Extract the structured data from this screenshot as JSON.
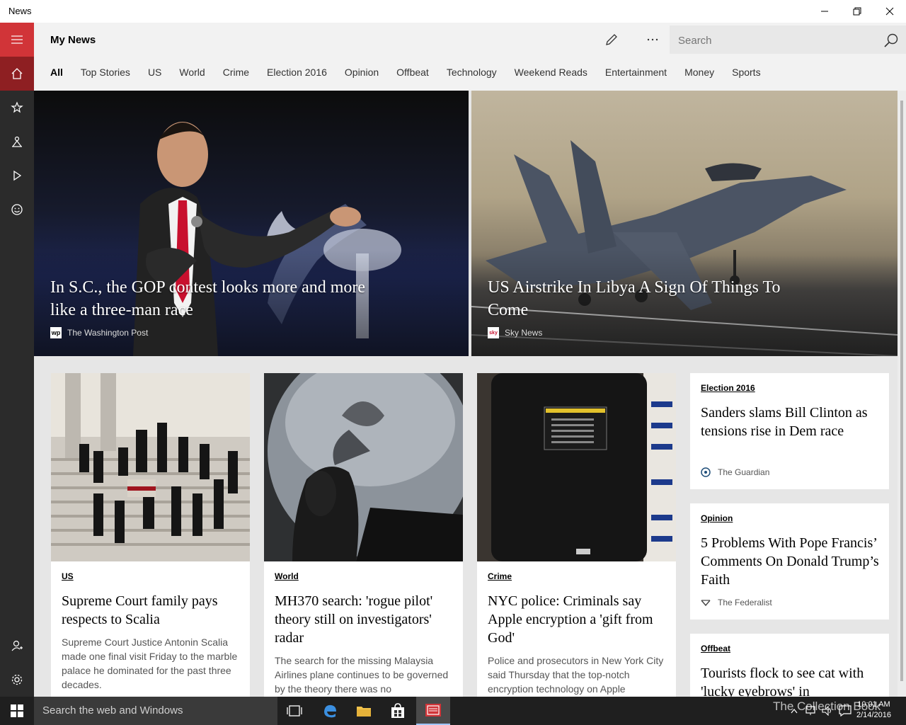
{
  "window": {
    "title": "News"
  },
  "header": {
    "page_title": "My News",
    "search": {
      "placeholder": "Search",
      "value": ""
    },
    "tabs": [
      "All",
      "Top Stories",
      "US",
      "World",
      "Crime",
      "Election 2016",
      "Opinion",
      "Offbeat",
      "Technology",
      "Weekend Reads",
      "Entertainment",
      "Money",
      "Sports"
    ],
    "active_tab": "All"
  },
  "rail": {
    "items": [
      "hamburger-icon",
      "home-icon",
      "interests-icon",
      "local-icon",
      "video-icon",
      "smiley-icon"
    ],
    "bottom": [
      "add-person-icon",
      "gear-icon"
    ],
    "accent": "#d13438"
  },
  "hero": [
    {
      "title": "In S.C., the GOP contest looks more and more like a three-man race",
      "source": "The Washington Post",
      "logo_text": "wp"
    },
    {
      "title": "US Airstrike In Libya A Sign Of Things To Come",
      "source": "Sky News",
      "logo_text": "sky"
    }
  ],
  "cards": [
    {
      "category": "US",
      "headline": "Supreme Court family pays respects to Scalia",
      "summary": "Supreme Court Justice Antonin Scalia made one final visit Friday to the marble palace he dominated for the past three decades."
    },
    {
      "category": "World",
      "headline": "MH370 search: 'rogue pilot' theory still on investigators' radar",
      "summary": "The search for the missing Malaysia Airlines plane continues to be governed by the theory there was no"
    },
    {
      "category": "Crime",
      "headline": "NYC police: Criminals say Apple encryption a 'gift from God'",
      "summary": "Police and prosecutors in New York City said Thursday that the top-notch encryption technology on Apple"
    }
  ],
  "side_cards": [
    {
      "category": "Election 2016",
      "headline": "Sanders slams Bill Clinton as tensions rise in Dem race",
      "source": "The Guardian"
    },
    {
      "category": "Opinion",
      "headline": "5 Problems With Pope Francis’ Comments On Donald Trump’s Faith",
      "source": "The Federalist"
    },
    {
      "category": "Offbeat",
      "headline": "Tourists flock to see cat with 'lucky eyebrows' in",
      "source": ""
    }
  ],
  "taskbar": {
    "search_placeholder": "Search the web and Windows",
    "time": "10:01 AM",
    "date": "2/14/2016"
  },
  "watermark": "The Collection Book"
}
